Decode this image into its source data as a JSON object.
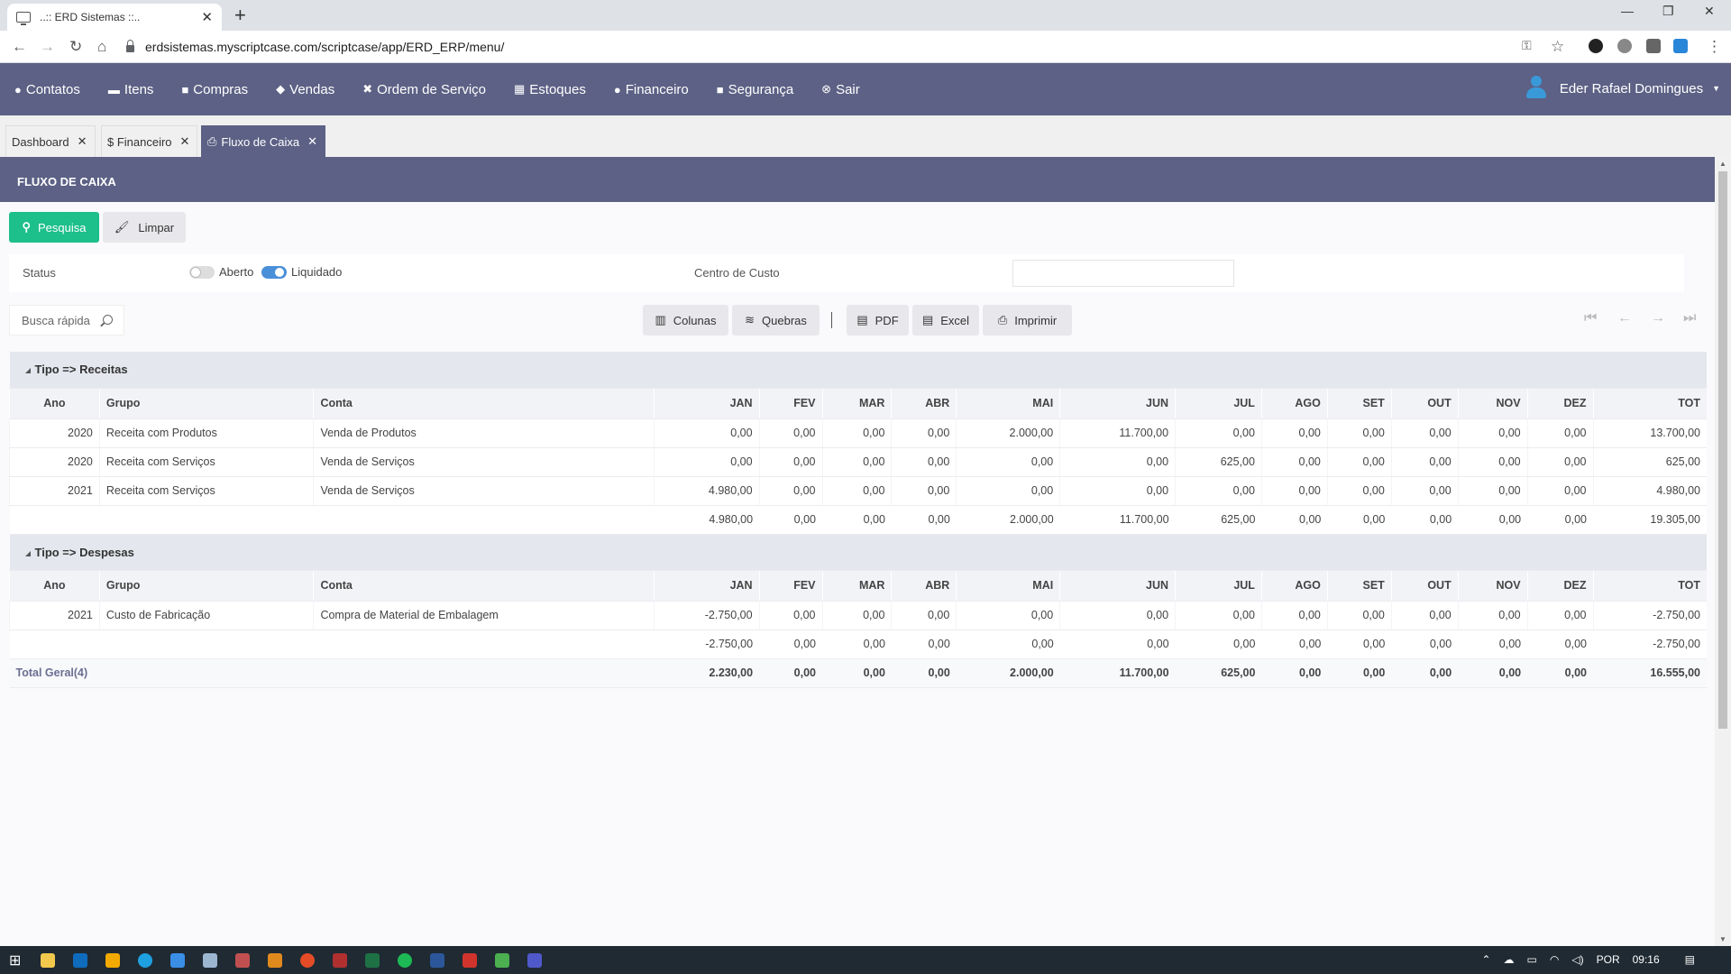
{
  "browser": {
    "tab_title": "..:: ERD Sistemas ::..",
    "url": "erdsistemas.myscriptcase.com/scriptcase/app/ERD_ERP/menu/"
  },
  "nav": {
    "items": [
      "Contatos",
      "Itens",
      "Compras",
      "Vendas",
      "Ordem de Serviço",
      "Estoques",
      "Financeiro",
      "Segurança",
      "Sair"
    ],
    "user": "Eder Rafael Domingues"
  },
  "tabs": [
    "Dashboard",
    "$ Financeiro",
    "Fluxo de Caixa"
  ],
  "page_title": "FLUXO DE CAIXA",
  "buttons": {
    "search": "Pesquisa",
    "clear": "Limpar"
  },
  "filters": {
    "status_label": "Status",
    "open_label": "Aberto",
    "paid_label": "Liquidado",
    "cost_center_label": "Centro de Custo"
  },
  "toolbar": {
    "quick_search": "Busca rápida",
    "columns": "Colunas",
    "breaks": "Quebras",
    "pdf": "PDF",
    "excel": "Excel",
    "print": "Imprimir"
  },
  "table": {
    "headers": [
      "Ano",
      "Grupo",
      "Conta",
      "JAN",
      "FEV",
      "MAR",
      "ABR",
      "MAI",
      "JUN",
      "JUL",
      "AGO",
      "SET",
      "OUT",
      "NOV",
      "DEZ",
      "TOT"
    ],
    "groups": [
      {
        "label": "Tipo => Receitas",
        "rows": [
          [
            "2020",
            "Receita com Produtos",
            "Venda de Produtos",
            "0,00",
            "0,00",
            "0,00",
            "0,00",
            "2.000,00",
            "11.700,00",
            "0,00",
            "0,00",
            "0,00",
            "0,00",
            "0,00",
            "0,00",
            "13.700,00"
          ],
          [
            "2020",
            "Receita com Serviços",
            "Venda de Serviços",
            "0,00",
            "0,00",
            "0,00",
            "0,00",
            "0,00",
            "0,00",
            "625,00",
            "0,00",
            "0,00",
            "0,00",
            "0,00",
            "0,00",
            "625,00"
          ],
          [
            "2021",
            "Receita com Serviços",
            "Venda de Serviços",
            "4.980,00",
            "0,00",
            "0,00",
            "0,00",
            "0,00",
            "0,00",
            "0,00",
            "0,00",
            "0,00",
            "0,00",
            "0,00",
            "0,00",
            "4.980,00"
          ]
        ],
        "subtotal": [
          "4.980,00",
          "0,00",
          "0,00",
          "0,00",
          "2.000,00",
          "11.700,00",
          "625,00",
          "0,00",
          "0,00",
          "0,00",
          "0,00",
          "0,00",
          "19.305,00"
        ]
      },
      {
        "label": "Tipo => Despesas",
        "rows": [
          [
            "2021",
            "Custo de Fabricação",
            "Compra de Material de Embalagem",
            "-2.750,00",
            "0,00",
            "0,00",
            "0,00",
            "0,00",
            "0,00",
            "0,00",
            "0,00",
            "0,00",
            "0,00",
            "0,00",
            "0,00",
            "-2.750,00"
          ]
        ],
        "subtotal": [
          "-2.750,00",
          "0,00",
          "0,00",
          "0,00",
          "0,00",
          "0,00",
          "0,00",
          "0,00",
          "0,00",
          "0,00",
          "0,00",
          "0,00",
          "-2.750,00"
        ]
      }
    ],
    "grand_total_label": "Total Geral(4)",
    "grand_total": [
      "2.230,00",
      "0,00",
      "0,00",
      "0,00",
      "2.000,00",
      "11.700,00",
      "625,00",
      "0,00",
      "0,00",
      "0,00",
      "0,00",
      "0,00",
      "16.555,00"
    ]
  },
  "taskbar": {
    "lang": "POR",
    "time": "09:16"
  },
  "colors": {
    "nav": "#5c6185",
    "primary_button": "#1dbf8a",
    "group_row": "#e4e7ee"
  }
}
